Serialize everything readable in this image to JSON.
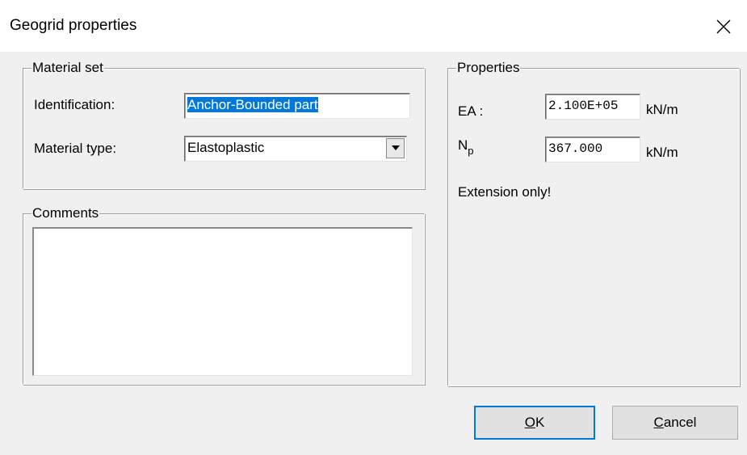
{
  "window": {
    "title": "Geogrid properties",
    "close_icon": "close-icon"
  },
  "material_set": {
    "legend": "Material set",
    "identification_label": "Identification:",
    "identification_value": "Anchor-Bounded part",
    "material_type_label": "Material type:",
    "material_type_value": "Elastoplastic",
    "dropdown_icon": "chevron-down-icon"
  },
  "comments": {
    "legend": "Comments",
    "value": ""
  },
  "properties": {
    "legend": "Properties",
    "ea_label": "EA :",
    "ea_value": "2.100E+05",
    "ea_unit": "kN/m",
    "np_label_main": "N",
    "np_label_sub": "p",
    "np_value": "367.000",
    "np_unit": "kN/m",
    "note": "Extension only!"
  },
  "buttons": {
    "ok_mnemonic": "O",
    "ok_rest": "K",
    "cancel_mnemonic": "C",
    "cancel_rest": "ancel"
  },
  "colors": {
    "selection": "#0078d7",
    "dialog_bg": "#f0f0f0"
  }
}
